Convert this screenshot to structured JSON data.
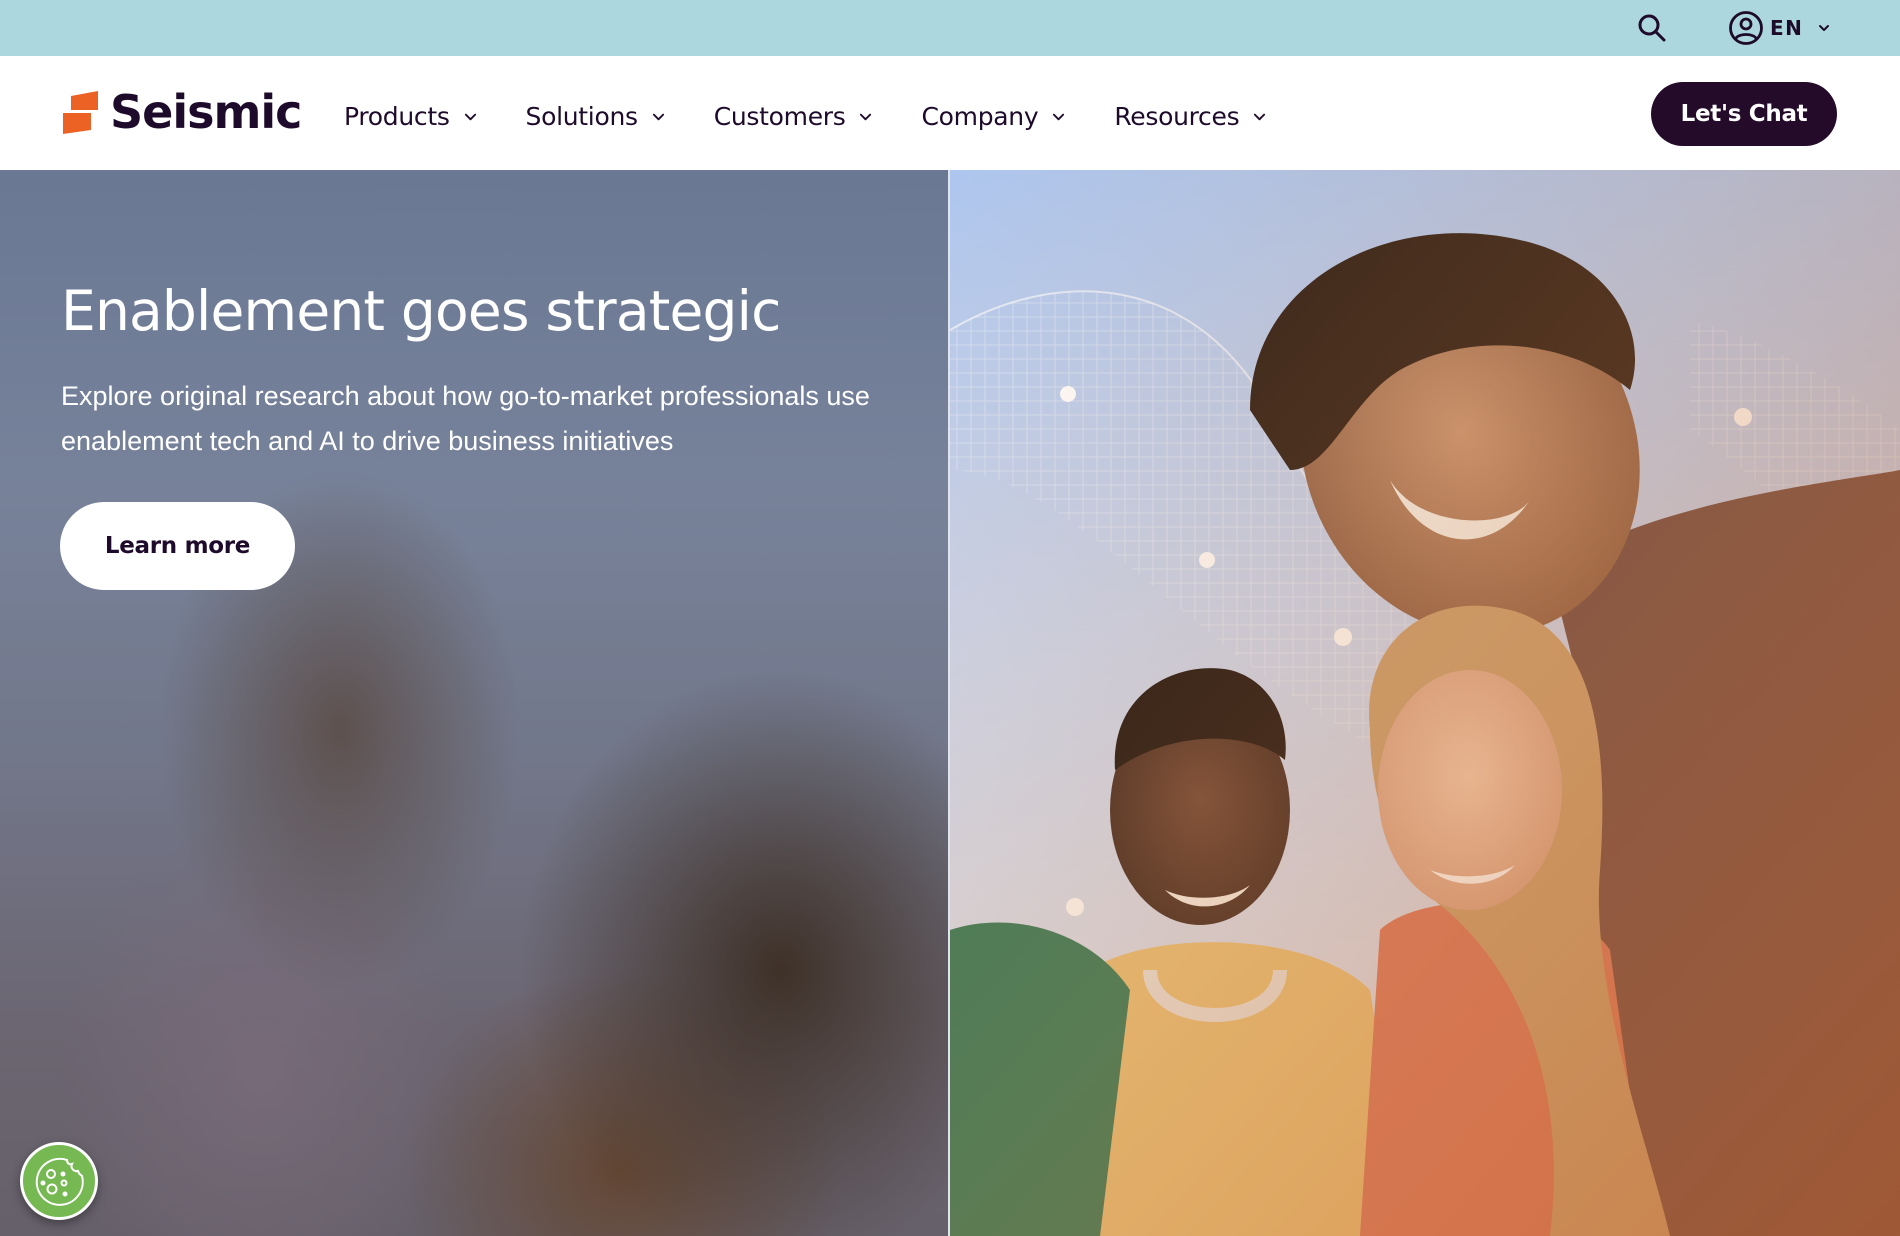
{
  "utility_bar": {
    "search_icon": "search-icon",
    "account_icon": "user-circle-icon",
    "language": "EN",
    "language_chevron": "chevron-down-icon"
  },
  "nav": {
    "brand": "Seismic",
    "items": [
      {
        "label": "Products"
      },
      {
        "label": "Solutions"
      },
      {
        "label": "Customers"
      },
      {
        "label": "Company"
      },
      {
        "label": "Resources"
      }
    ],
    "cta_label": "Let's Chat"
  },
  "hero": {
    "headline": "Enablement goes strategic",
    "subtext": "Explore original research about how go-to-market professionals use enablement tech and AI to drive business initiatives",
    "cta_label": "Learn more",
    "image_alt": "Group of smiling young people outdoors under a blue sky"
  },
  "cookie": {
    "icon": "cookie-icon"
  },
  "colors": {
    "utility_bar_bg": "#acd7de",
    "brand_dark": "#1e0b2b",
    "brand_orange": "#ec6224",
    "cookie_green": "#76b852"
  }
}
